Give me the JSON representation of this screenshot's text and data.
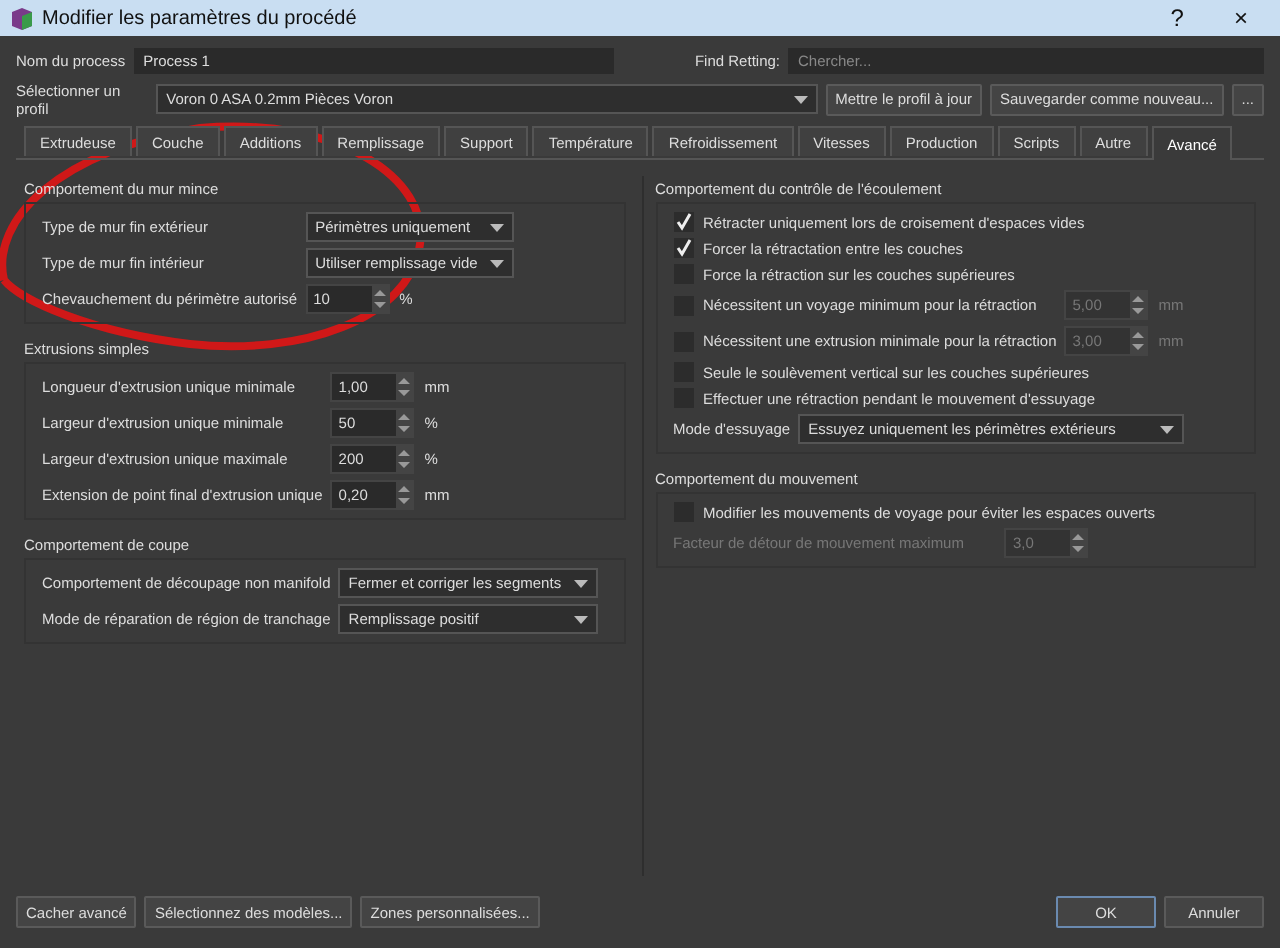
{
  "window": {
    "title": "Modifier les paramètres du procédé",
    "help": "?",
    "close": "×"
  },
  "process_name": {
    "label": "Nom du process",
    "value": "Process 1"
  },
  "find_setting": {
    "label": "Find Retting:",
    "placeholder": "Chercher..."
  },
  "profile": {
    "label": "Sélectionner un profil",
    "value": "Voron 0 ASA 0.2mm Pièces Voron",
    "buttons": [
      "Mettre le profil à jour",
      "Sauvegarder comme nouveau...",
      "..."
    ]
  },
  "tabs": [
    {
      "label": "Extrudeuse",
      "selected": false
    },
    {
      "label": "Couche",
      "selected": false
    },
    {
      "label": "Additions",
      "selected": false
    },
    {
      "label": "Remplissage",
      "selected": false
    },
    {
      "label": "Support",
      "selected": false
    },
    {
      "label": "Température",
      "selected": false
    },
    {
      "label": "Refroidissement",
      "selected": false
    },
    {
      "label": "Vitesses",
      "selected": false
    },
    {
      "label": "Production",
      "selected": false
    },
    {
      "label": "Scripts",
      "selected": false
    },
    {
      "label": "Autre",
      "selected": false
    },
    {
      "label": "Avancé",
      "selected": true
    }
  ],
  "left_column": [
    {
      "title": "Comportement du mur mince",
      "rows": [
        {
          "kind": "combo",
          "label": "Type de mur fin extérieur",
          "value": "Périmètres uniquement"
        },
        {
          "kind": "combo",
          "label": "Type de mur fin intérieur",
          "value": "Utiliser remplissage vide"
        },
        {
          "kind": "spin",
          "label": "Chevauchement du périmètre autorisé",
          "value": "10",
          "unit": "%",
          "disabled": false
        }
      ]
    },
    {
      "title": "Extrusions simples",
      "rows": [
        {
          "kind": "spin",
          "label": "Longueur d'extrusion unique minimale",
          "value": "1,00",
          "unit": "mm",
          "disabled": false
        },
        {
          "kind": "spin",
          "label": "Largeur d'extrusion unique minimale",
          "value": "50",
          "unit": "%",
          "disabled": false
        },
        {
          "kind": "spin",
          "label": "Largeur d'extrusion unique maximale",
          "value": "200",
          "unit": "%",
          "disabled": false
        },
        {
          "kind": "spin",
          "label": "Extension de point final d'extrusion unique",
          "value": "0,20",
          "unit": "mm",
          "disabled": false
        }
      ]
    },
    {
      "title": "Comportement de coupe",
      "rows": [
        {
          "kind": "combo",
          "label": "Comportement de découpage non manifold",
          "value": "Fermer et corriger les segments"
        },
        {
          "kind": "combo",
          "label": "Mode de réparation de région de tranchage",
          "value": "Remplissage positif"
        }
      ]
    }
  ],
  "right_column": [
    {
      "title": "Comportement du contrôle de l'écoulement",
      "rows": [
        {
          "kind": "checkbox",
          "label": "Rétracter uniquement lors de croisement d'espaces vides",
          "checked": true
        },
        {
          "kind": "checkbox",
          "label": "Forcer la rétractation entre les couches",
          "checked": true
        },
        {
          "kind": "checkbox",
          "label": "Force la rétraction sur les couches supérieures",
          "checked": false
        },
        {
          "kind": "checkbox_spin",
          "label": "Nécessitent un voyage minimum pour la rétraction",
          "checked": false,
          "value": "5,00",
          "unit": "mm",
          "disabled": true
        },
        {
          "kind": "checkbox_spin",
          "label": "Nécessitent une extrusion minimale pour la rétraction",
          "checked": false,
          "value": "3,00",
          "unit": "mm",
          "disabled": true
        },
        {
          "kind": "checkbox",
          "label": "Seule le soulèvement vertical sur les couches supérieures",
          "checked": false
        },
        {
          "kind": "checkbox",
          "label": "Effectuer une rétraction pendant le mouvement d'essuyage",
          "checked": false
        },
        {
          "kind": "combo",
          "label": "Mode d'essuyage",
          "value": "Essuyez uniquement les périmètres extérieurs"
        }
      ]
    },
    {
      "title": "Comportement du mouvement",
      "rows": [
        {
          "kind": "checkbox",
          "label": "Modifier les mouvements de voyage pour éviter les espaces ouverts",
          "checked": false
        },
        {
          "kind": "spin",
          "label": "Facteur de détour de mouvement maximum",
          "value": "3,0",
          "disabled": true
        }
      ]
    }
  ],
  "footer": {
    "left_buttons": [
      "Cacher avancé",
      "Sélectionnez des modèles...",
      "Zones personnalisées..."
    ],
    "ok": "OK",
    "cancel": "Annuler"
  }
}
